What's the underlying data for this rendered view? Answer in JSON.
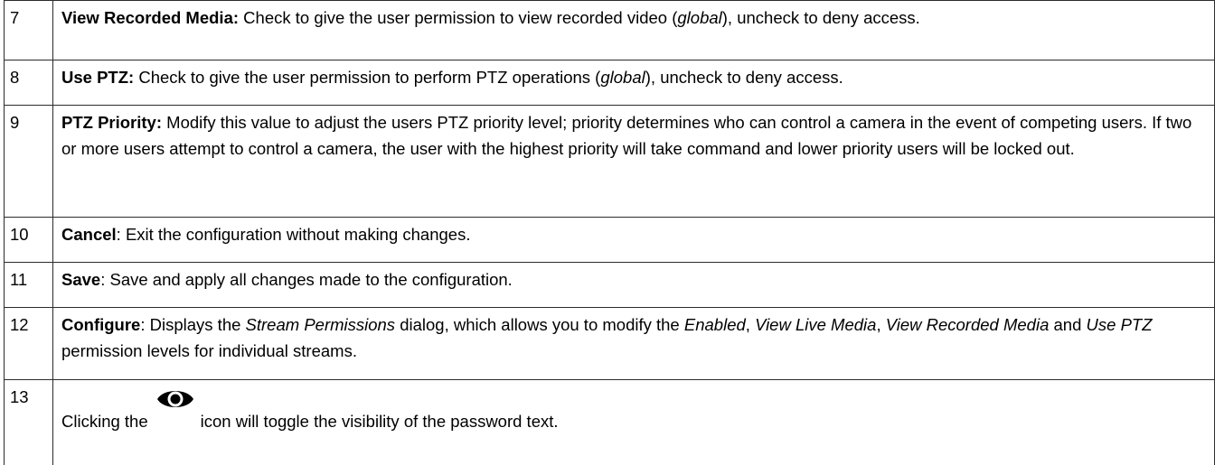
{
  "rows": [
    {
      "num": "7",
      "title": "View Recorded Media:",
      "text_1": " Check to give the user permission to view recorded video (",
      "italic_1": "global",
      "text_2": "), uncheck to deny access."
    },
    {
      "num": "8",
      "title": "Use PTZ:",
      "text_1": " Check to give the user permission to perform PTZ operations (",
      "italic_1": "global",
      "text_2": "), uncheck to deny access."
    },
    {
      "num": "9",
      "title": "PTZ Priority:",
      "text_1": " Modify this value to adjust the users PTZ priority level; priority determines who can control a camera in the event of competing users. If two or more users attempt to control a camera, the user with the highest priority will take command and lower priority users will be locked out."
    },
    {
      "num": "10",
      "title": "Cancel",
      "text_1": ": Exit the configuration without making changes."
    },
    {
      "num": "11",
      "title": "Save",
      "text_1": ": Save and apply all changes made to the configuration."
    },
    {
      "num": "12",
      "title": "Configure",
      "text_1": ": Displays the ",
      "italic_1": "Stream Permissions",
      "text_2": " dialog, which allows you to modify the ",
      "italic_2": "Enabled",
      "text_3": ", ",
      "italic_3": "View Live Media",
      "text_4": ", ",
      "italic_4": "View Recorded Media",
      "text_5": " and ",
      "italic_5": "Use PTZ",
      "text_6": " permission levels for individual streams."
    },
    {
      "num": "13",
      "text_before_icon": "Clicking the",
      "icon": "eye-icon",
      "text_after_icon": "icon will toggle the visibility of the password text."
    }
  ]
}
